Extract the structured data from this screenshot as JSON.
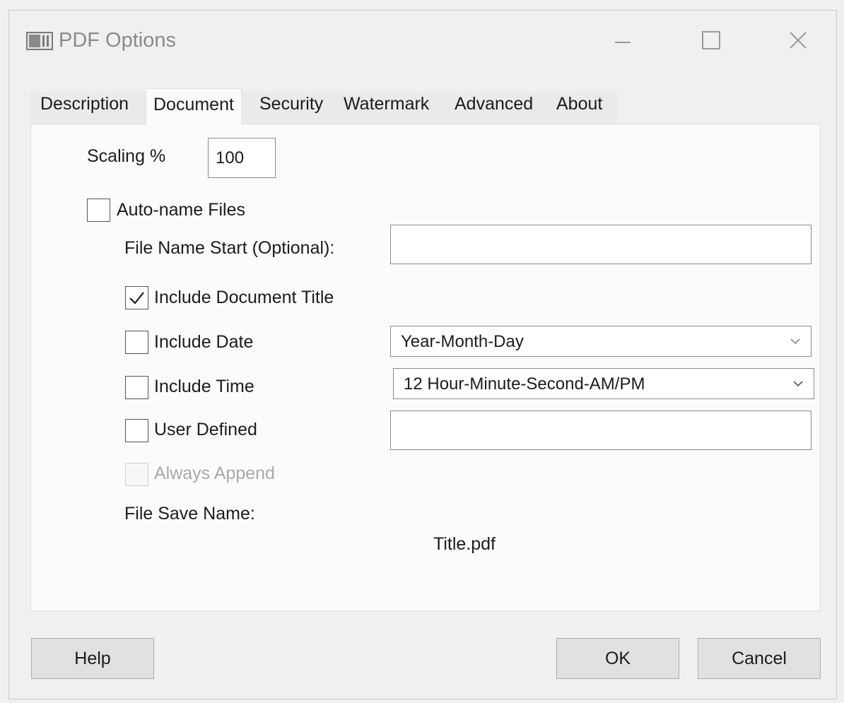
{
  "window": {
    "title": "PDF Options",
    "icon": "app-window-icon",
    "controls": [
      "minimize-icon",
      "maximize-icon",
      "close-icon"
    ]
  },
  "tabs": [
    {
      "label": "Description"
    },
    {
      "label": "Document",
      "active": true
    },
    {
      "label": "Security"
    },
    {
      "label": "Watermark"
    },
    {
      "label": "Advanced"
    },
    {
      "label": "About"
    }
  ],
  "document": {
    "scaling": {
      "label": "Scaling %",
      "value": "100"
    },
    "auto_name": {
      "label": "Auto-name Files",
      "checked": false
    },
    "file_name_start": {
      "label": "File Name Start (Optional):",
      "value": ""
    },
    "include_title": {
      "label": "Include Document Title",
      "checked": true
    },
    "include_date": {
      "label": "Include Date",
      "checked": false,
      "format": "Year-Month-Day"
    },
    "include_time": {
      "label": "Include Time",
      "checked": false,
      "format": "12 Hour-Minute-Second-AM/PM"
    },
    "user_defined": {
      "label": "User Defined",
      "checked": false,
      "value": ""
    },
    "always_append": {
      "label": "Always Append",
      "checked": false,
      "enabled": false
    },
    "file_save_name": {
      "label": "File Save Name:",
      "value": "Title.pdf"
    }
  },
  "buttons": {
    "help": "Help",
    "ok": "OK",
    "cancel": "Cancel"
  },
  "colors": {
    "window_bg": "#f0f0f0",
    "panel_bg": "#fbfbfb",
    "button_bg": "#e1e1e1",
    "disabled_text": "#a9a9a9"
  }
}
